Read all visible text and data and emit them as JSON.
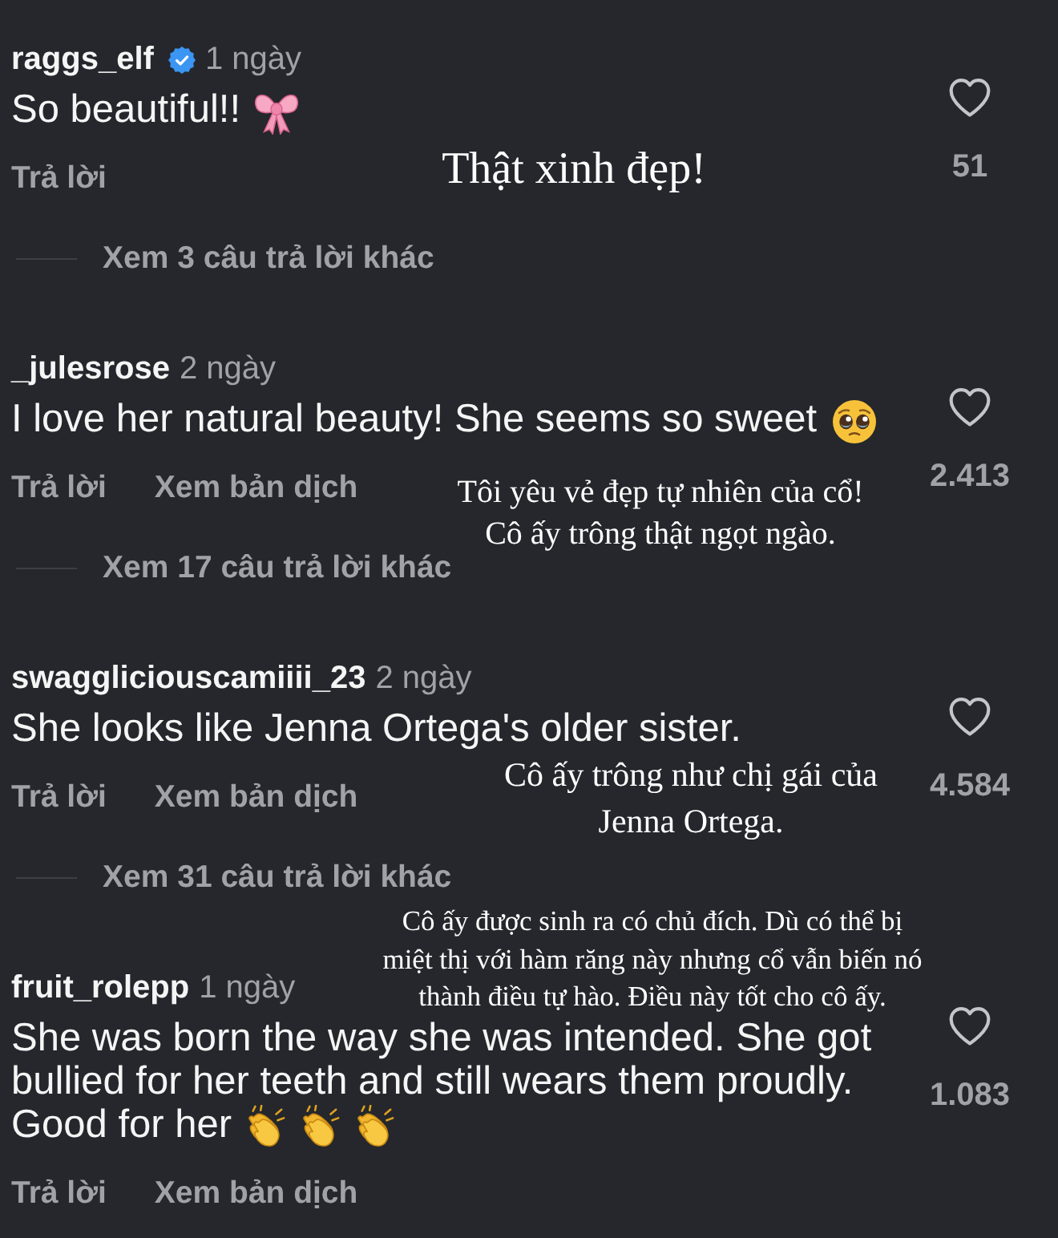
{
  "comments": [
    {
      "username": "raggs_elf",
      "verified": true,
      "time": "1 ngày",
      "text": [
        "So beautiful!!"
      ],
      "emojis": [
        {
          "kind": "bow"
        }
      ],
      "actions": [
        "Trả lời"
      ],
      "liked": false,
      "likes": "51",
      "more_replies": "Xem 3 câu trả lời khác",
      "translation": "Thật xinh đẹp!"
    },
    {
      "username": "_julesrose",
      "verified": false,
      "time": "2 ngày",
      "text": [
        "I love her natural beauty! She seems so sweet"
      ],
      "emojis": [
        {
          "kind": "pleading"
        }
      ],
      "actions": [
        "Trả lời",
        "Xem bản dịch"
      ],
      "liked": false,
      "likes": "2.413",
      "more_replies": "Xem 17 câu trả lời khác",
      "translation": "Tôi yêu vẻ đẹp tự nhiên của cổ!\nCô ấy trông thật ngọt ngào."
    },
    {
      "username": "swaggliciouscamiiii_23",
      "verified": false,
      "time": "2 ngày",
      "text": [
        "She looks like Jenna Ortega's older sister."
      ],
      "actions": [
        "Trả lời",
        "Xem bản dịch"
      ],
      "liked": false,
      "likes": "4.584",
      "more_replies": "Xem 31 câu trả lời khác",
      "translation": "Cô ấy trông như chị gái của\nJenna Ortega."
    },
    {
      "username": "fruit_rolepp",
      "verified": false,
      "time": "1 ngày",
      "text": [
        "She was born the way she was intended. She got\nbullied for her teeth and still wears them proudly.",
        "Good for her"
      ],
      "emojis": [
        {
          "kind": "clap"
        },
        {
          "kind": "clap"
        },
        {
          "kind": "clap"
        }
      ],
      "actions": [
        "Trả lời",
        "Xem bản dịch"
      ],
      "liked": false,
      "likes": "1.083",
      "translation": "Cô ấy được sinh ra có chủ đích. Dù có thể bị\nmiệt thị với hàm răng này nhưng cổ vẫn biến nó\nthành điều tự hào. Điều này tốt cho cô ấy."
    }
  ]
}
